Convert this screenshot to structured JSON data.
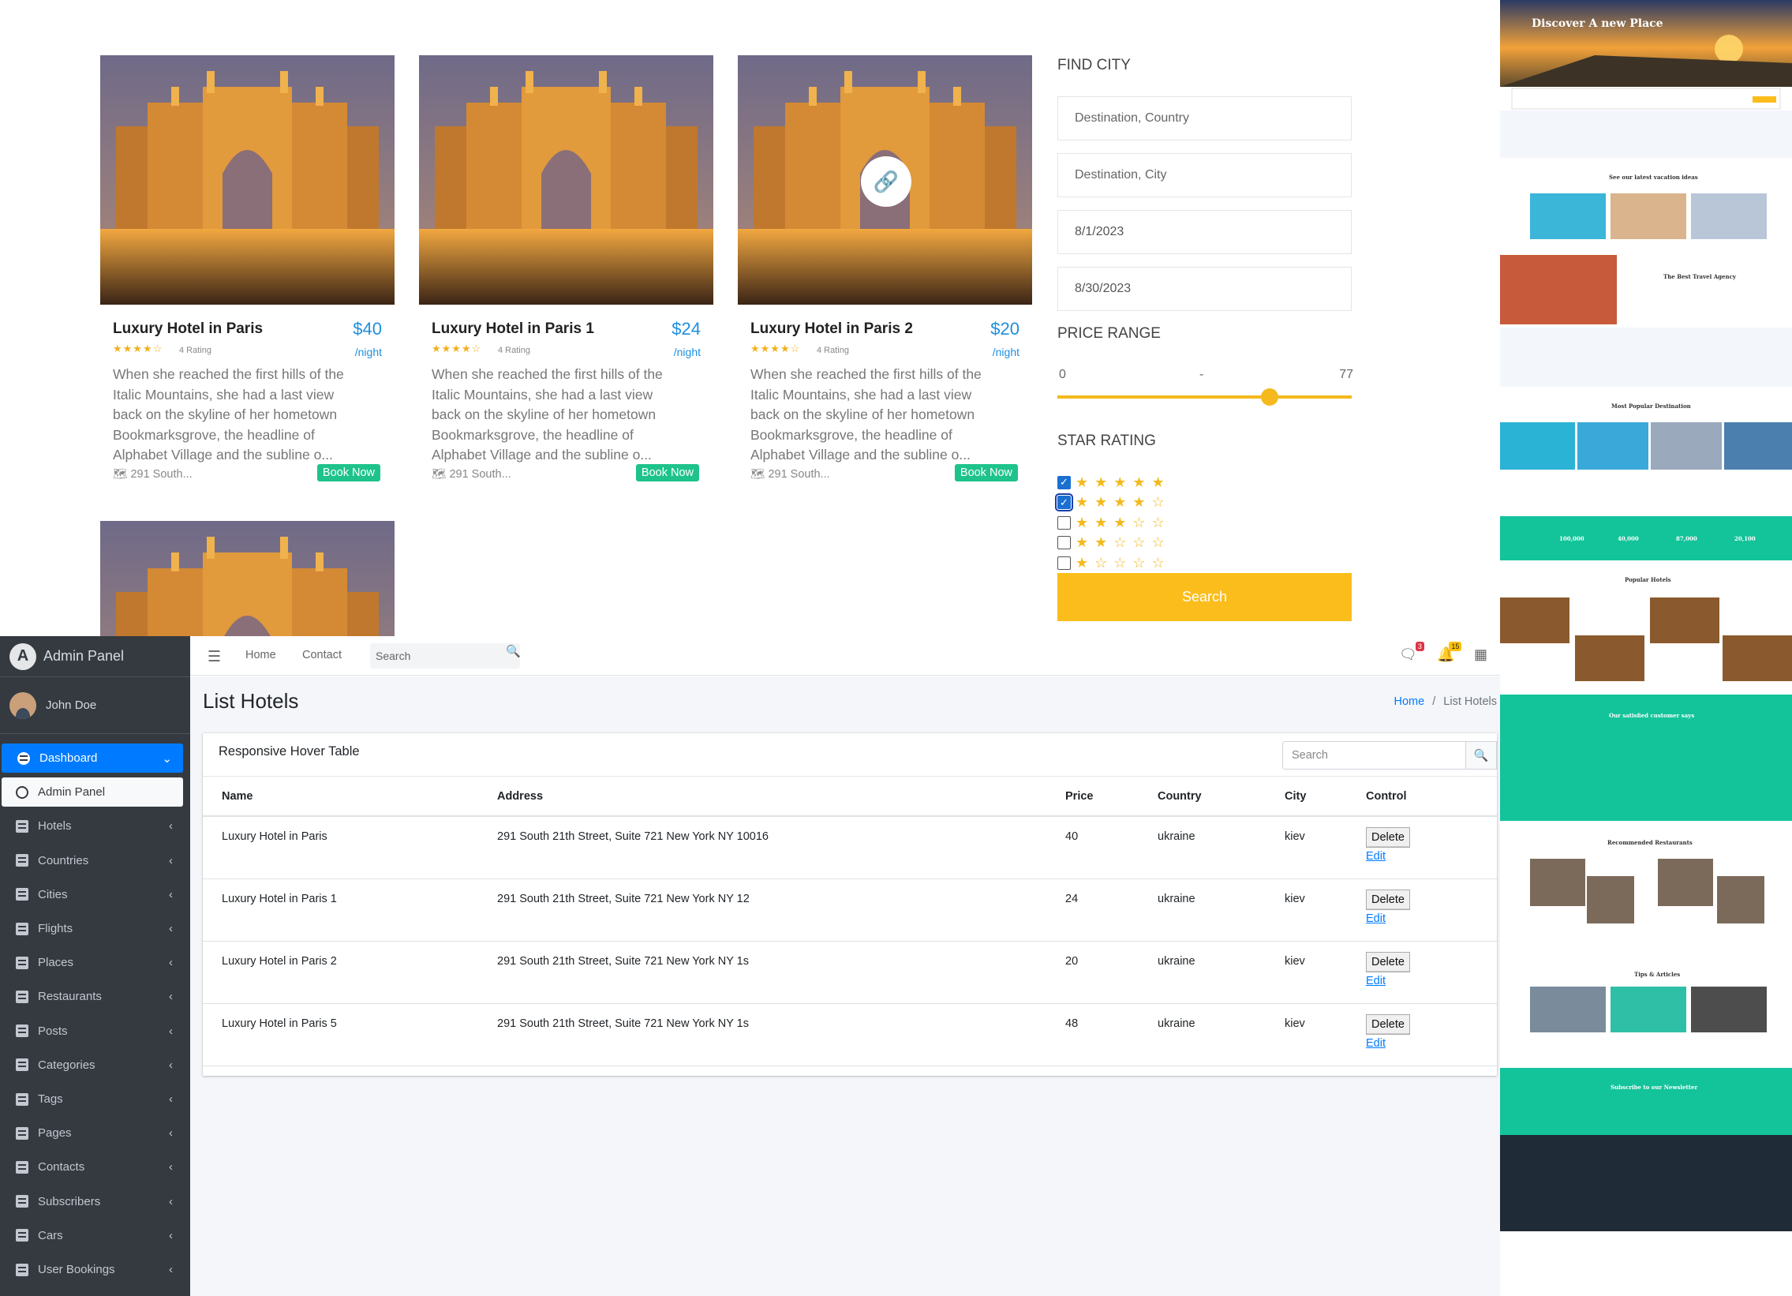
{
  "hotels": [
    {
      "name": "Luxury Hotel in Paris",
      "price": "$40",
      "per": "/night",
      "stars": "★★★★☆",
      "rating": "4 Rating",
      "desc": "When she reached the first hills of the Italic Mountains, she had a last view back on the skyline of her hometown Bookmarksgrove, the headline of Alphabet Village and the subline o...",
      "address": "291 South...",
      "book": "Book Now"
    },
    {
      "name": "Luxury Hotel in Paris 1",
      "price": "$24",
      "per": "/night",
      "stars": "★★★★☆",
      "rating": "4 Rating",
      "desc": "When she reached the first hills of the Italic Mountains, she had a last view back on the skyline of her hometown Bookmarksgrove, the headline of Alphabet Village and the subline o...",
      "address": "291 South...",
      "book": "Book Now"
    },
    {
      "name": "Luxury Hotel in Paris 2",
      "price": "$20",
      "per": "/night",
      "stars": "★★★★☆",
      "rating": "4 Rating",
      "desc": "When she reached the first hills of the Italic Mountains, she had a last view back on the skyline of her hometown Bookmarksgrove, the headline of Alphabet Village and the subline o...",
      "address": "291 South...",
      "book": "Book Now"
    }
  ],
  "filter": {
    "find_city": "FIND CITY",
    "country_placeholder": "Destination, Country",
    "city_placeholder": "Destination, City",
    "date_from": "8/1/2023",
    "date_to": "8/30/2023",
    "price_range": "PRICE RANGE",
    "price_min": "0",
    "price_dash": "-",
    "price_max": "77",
    "price_value_fraction": 0.77,
    "star_rating": "STAR RATING",
    "stars": [
      {
        "glyphs": "★★★★★",
        "checked": true
      },
      {
        "glyphs": "★★★★☆",
        "checked": true
      },
      {
        "glyphs": "★★★☆☆",
        "checked": false
      },
      {
        "glyphs": "★★☆☆☆",
        "checked": false
      },
      {
        "glyphs": "★☆☆☆☆",
        "checked": false
      }
    ],
    "search": "Search"
  },
  "admin": {
    "brand": "Admin Panel",
    "user": "John Doe",
    "nav": [
      {
        "label": "Dashboard",
        "icon": "dashboard-icon",
        "active": true
      },
      {
        "label": "Admin Panel",
        "icon": "circle-icon",
        "sub": true
      },
      {
        "label": "Hotels",
        "icon": "book-icon"
      },
      {
        "label": "Countries",
        "icon": "book-icon"
      },
      {
        "label": "Cities",
        "icon": "book-icon"
      },
      {
        "label": "Flights",
        "icon": "book-icon"
      },
      {
        "label": "Places",
        "icon": "book-icon"
      },
      {
        "label": "Restaurants",
        "icon": "book-icon"
      },
      {
        "label": "Posts",
        "icon": "book-icon"
      },
      {
        "label": "Categories",
        "icon": "book-icon"
      },
      {
        "label": "Tags",
        "icon": "book-icon"
      },
      {
        "label": "Pages",
        "icon": "book-icon"
      },
      {
        "label": "Contacts",
        "icon": "book-icon"
      },
      {
        "label": "Subscribers",
        "icon": "book-icon"
      },
      {
        "label": "Cars",
        "icon": "book-icon"
      },
      {
        "label": "User Bookings",
        "icon": "book-icon"
      }
    ],
    "topbar": {
      "home": "Home",
      "contact": "Contact",
      "search_placeholder": "Search",
      "messages_count": "3",
      "notifications_count": "15"
    },
    "page_title": "List Hotels",
    "breadcrumb": {
      "home": "Home",
      "sep": "/",
      "current": "List Hotels"
    },
    "card_title": "Responsive Hover Table",
    "card_search_placeholder": "Search",
    "columns": [
      "Name",
      "Address",
      "Price",
      "Country",
      "City",
      "Control"
    ],
    "rows": [
      {
        "name": "Luxury Hotel in Paris",
        "address": "291 South 21th Street, Suite 721 New York NY 10016",
        "price": "40",
        "country": "ukraine",
        "city": "kiev"
      },
      {
        "name": "Luxury Hotel in Paris 1",
        "address": "291 South 21th Street, Suite 721 New York NY 12",
        "price": "24",
        "country": "ukraine",
        "city": "kiev"
      },
      {
        "name": "Luxury Hotel in Paris 2",
        "address": "291 South 21th Street, Suite 721 New York NY 1s",
        "price": "20",
        "country": "ukraine",
        "city": "kiev"
      },
      {
        "name": "Luxury Hotel in Paris 5",
        "address": "291 South 21th Street, Suite 721 New York NY 1s",
        "price": "48",
        "country": "ukraine",
        "city": "kiev"
      }
    ],
    "delete": "Delete",
    "edit": "Edit"
  },
  "thumbnail": {
    "hero": "Discover A new Place",
    "latest": "See our latest vacation ideas",
    "agency": "The Best Travel Agency",
    "popular_dest": "Most Popular Destination",
    "stats": [
      "100,000",
      "40,000",
      "87,000",
      "20,100"
    ],
    "popular_hotels": "Popular Hotels",
    "customers": "Our satisfied customer says",
    "restaurants": "Recommended Restaurants",
    "tips": "Tips & Articles",
    "newsletter": "Subscribe to our Newsletter"
  },
  "colors": {
    "accent_yellow": "#fbbd1c",
    "price_blue": "#1e8fe0",
    "book_green": "#1ec38b",
    "admin_blue": "#007bff",
    "sidebar_dark": "#343a40",
    "teal": "#13c39a"
  }
}
